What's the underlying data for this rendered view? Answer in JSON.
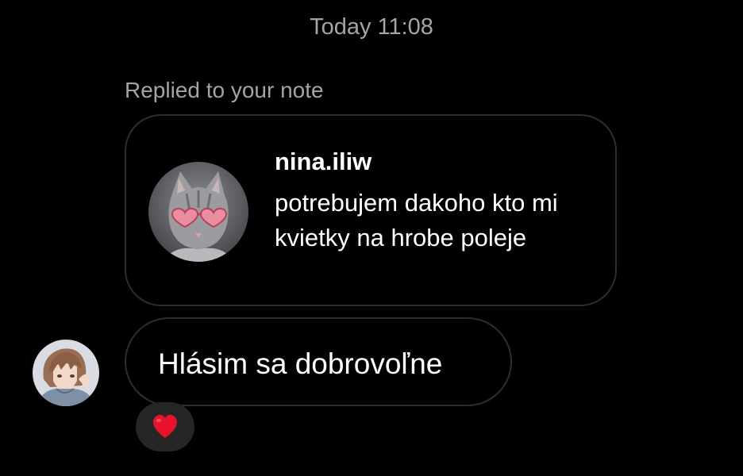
{
  "thread": {
    "timestamp": "Today 11:08",
    "reply_label": "Replied to your note"
  },
  "note": {
    "username": "nina.iliw",
    "text": "potrebujem dakoho kto mi kvietky na hrobe poleje",
    "avatar_icon": "cat-with-heart-sunglasses-avatar"
  },
  "message": {
    "text": "Hlásim sa dobrovoľne",
    "sender_avatar_icon": "anime-character-avatar",
    "reaction_icon": "red-heart-icon"
  },
  "colors": {
    "background": "#000000",
    "secondary_text": "#a4a4a4",
    "border": "#2e2e2e",
    "reaction_pill": "#262626",
    "heart": "#e8132b"
  }
}
